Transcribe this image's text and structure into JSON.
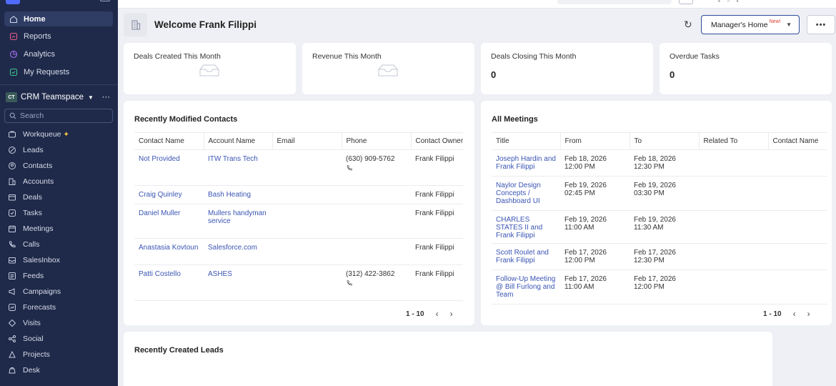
{
  "sidebar": {
    "nav": [
      {
        "label": "Home",
        "icon": "home-icon"
      },
      {
        "label": "Reports",
        "icon": "reports-icon"
      },
      {
        "label": "Analytics",
        "icon": "analytics-icon"
      },
      {
        "label": "My Requests",
        "icon": "requests-icon"
      }
    ],
    "team": {
      "badge": "CT",
      "name": "CRM Teamspace",
      "more": "···"
    },
    "search_placeholder": "Search",
    "modules": [
      {
        "label": "Workqueue",
        "icon": "workqueue-icon"
      },
      {
        "label": "Leads",
        "icon": "leads-icon"
      },
      {
        "label": "Contacts",
        "icon": "contacts-icon"
      },
      {
        "label": "Accounts",
        "icon": "accounts-icon"
      },
      {
        "label": "Deals",
        "icon": "deals-icon"
      },
      {
        "label": "Tasks",
        "icon": "tasks-icon"
      },
      {
        "label": "Meetings",
        "icon": "meetings-icon"
      },
      {
        "label": "Calls",
        "icon": "calls-icon"
      },
      {
        "label": "SalesInbox",
        "icon": "salesinbox-icon"
      },
      {
        "label": "Feeds",
        "icon": "feeds-icon"
      },
      {
        "label": "Campaigns",
        "icon": "campaigns-icon"
      },
      {
        "label": "Forecasts",
        "icon": "forecasts-icon"
      },
      {
        "label": "Visits",
        "icon": "visits-icon"
      },
      {
        "label": "Social",
        "icon": "social-icon"
      },
      {
        "label": "Projects",
        "icon": "projects-icon"
      },
      {
        "label": "Desk",
        "icon": "desk-icon"
      }
    ],
    "active_color": "#2f3c64",
    "bg_color": "#1f2a4a"
  },
  "header": {
    "title": "Welcome Frank Filippi",
    "view_selector": {
      "label": "Manager's Home",
      "badge": "New!"
    },
    "more_label": "•••"
  },
  "kpis": [
    {
      "label": "Deals Created This Month",
      "value": ""
    },
    {
      "label": "Revenue This Month",
      "value": ""
    },
    {
      "label": "Deals Closing This Month",
      "value": "0"
    },
    {
      "label": "Overdue Tasks",
      "value": "0"
    }
  ],
  "contacts_panel": {
    "title": "Recently Modified Contacts",
    "columns": [
      "Contact Name",
      "Account Name",
      "Email",
      "Phone",
      "Contact Owner"
    ],
    "rows": [
      {
        "name": "Not Provided",
        "account": "ITW Trans Tech",
        "email": "",
        "phone": "(630) 909-5762",
        "owner": "Frank Filippi"
      },
      {
        "name": "Craig Quinley",
        "account": "Bash Heating",
        "email": "",
        "phone": "",
        "owner": "Frank Filippi"
      },
      {
        "name": "Daniel Muller",
        "account": "Mullers handyman service",
        "email": "",
        "phone": "",
        "owner": "Frank Filippi"
      },
      {
        "name": "Anastasia Kovtoun",
        "account": "Salesforce.com",
        "email": "",
        "phone": "",
        "owner": "Frank Filippi"
      },
      {
        "name": "Patti Costello",
        "account": "ASHES",
        "email": "",
        "phone": "(312) 422-3862",
        "owner": "Frank Filippi"
      }
    ],
    "pager": "1 - 10"
  },
  "meetings_panel": {
    "title": "All Meetings",
    "columns": [
      "Title",
      "From",
      "To",
      "Related To",
      "Contact Name"
    ],
    "rows": [
      {
        "title": "Joseph Hardin and Frank Filippi",
        "from": "Feb 18, 2026 12:00 PM",
        "to": "Feb 18, 2026 12:30 PM",
        "related": "",
        "contact": ""
      },
      {
        "title": "Naylor Design Concepts / Dashboard UI",
        "from": "Feb 19, 2026 02:45 PM",
        "to": "Feb 19, 2026 03:30 PM",
        "related": "",
        "contact": ""
      },
      {
        "title": "CHARLES STATES II and Frank Filippi",
        "from": "Feb 19, 2026 11:00 AM",
        "to": "Feb 19, 2026 11:30 AM",
        "related": "",
        "contact": ""
      },
      {
        "title": "Scott Roulet and Frank Filippi",
        "from": "Feb 17, 2026 12:00 PM",
        "to": "Feb 17, 2026 12:30 PM",
        "related": "",
        "contact": ""
      },
      {
        "title": "Follow-Up Meeting @ Bill Furlong and Team",
        "from": "Feb 17, 2026 11:00 AM",
        "to": "Feb 17, 2026 12:00 PM",
        "related": "",
        "contact": ""
      }
    ],
    "pager": "1 - 10"
  },
  "leads_panel": {
    "title": "Recently Created Leads"
  },
  "colors": {
    "link": "#3a55b4",
    "accent_border": "#2f4a9a",
    "new_badge": "#e0392b"
  }
}
